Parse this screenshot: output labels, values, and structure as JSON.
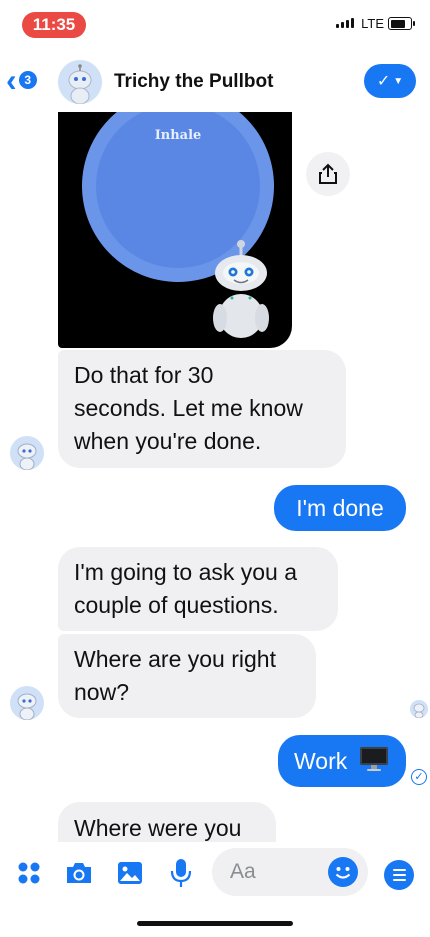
{
  "status_bar": {
    "time": "11:35",
    "network": "LTE"
  },
  "header": {
    "back_badge_count": "3",
    "bot_name": "Trichy the Pullbot"
  },
  "media": {
    "circle_label": "Inhale"
  },
  "messages": [
    {
      "sender": "bot",
      "lines": [
        "Do that for 30",
        "seconds. Let me know",
        "when you're done."
      ]
    },
    {
      "sender": "user",
      "text": "I'm done"
    },
    {
      "sender": "bot",
      "lines": [
        "I'm going to ask you a",
        "couple of questions."
      ]
    },
    {
      "sender": "bot",
      "lines": [
        "Where are you right",
        "now?"
      ]
    },
    {
      "sender": "user",
      "text": "Work",
      "emoji": "computer-icon"
    },
    {
      "sender": "bot",
      "lines": [
        "Where were you"
      ]
    }
  ],
  "composer": {
    "placeholder": "Aa"
  },
  "colors": {
    "accent": "#1877f2",
    "bubble_in": "#f0f0f3",
    "time_pill": "#ea4a43"
  }
}
